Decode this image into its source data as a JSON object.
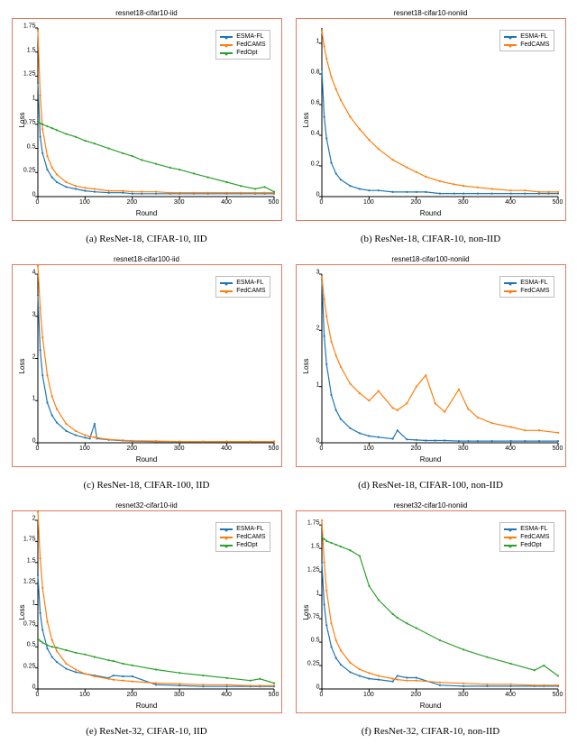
{
  "colors": {
    "blue": "#1f77b4",
    "orange": "#ff7f0e",
    "green": "#2ca02c"
  },
  "legend_labels": {
    "esma": "ESMA-FL",
    "fedcams": "FedCAMS",
    "fedopt": "FedOpt"
  },
  "axis_labels": {
    "x": "Round",
    "y": "Loss"
  },
  "chart_data": [
    {
      "id": "a",
      "title": "resnet18-cifar10-iid",
      "caption": "(a) ResNet-18, CIFAR-10, IID",
      "type": "line",
      "xlim": [
        0,
        500
      ],
      "ylim": [
        0.0,
        1.75
      ],
      "xticks": [
        0,
        100,
        200,
        300,
        400,
        500
      ],
      "yticks": [
        0.0,
        0.25,
        0.5,
        0.75,
        1.0,
        1.25,
        1.5,
        1.75
      ],
      "legend": [
        "esma",
        "fedcams",
        "fedopt"
      ],
      "x": [
        0,
        5,
        10,
        20,
        30,
        40,
        60,
        80,
        100,
        120,
        150,
        180,
        200,
        220,
        250,
        280,
        300,
        330,
        360,
        400,
        430,
        460,
        480,
        500
      ],
      "series": [
        {
          "key": "esma",
          "color": "blue",
          "values": [
            1.18,
            0.62,
            0.45,
            0.28,
            0.2,
            0.15,
            0.1,
            0.08,
            0.06,
            0.05,
            0.04,
            0.04,
            0.03,
            0.03,
            0.03,
            0.03,
            0.03,
            0.03,
            0.03,
            0.03,
            0.03,
            0.03,
            0.03,
            0.03
          ]
        },
        {
          "key": "fedcams",
          "color": "orange",
          "values": [
            1.72,
            1.05,
            0.7,
            0.42,
            0.3,
            0.23,
            0.15,
            0.11,
            0.09,
            0.08,
            0.06,
            0.06,
            0.05,
            0.05,
            0.05,
            0.04,
            0.04,
            0.04,
            0.04,
            0.04,
            0.04,
            0.04,
            0.04,
            0.04
          ]
        },
        {
          "key": "fedopt",
          "color": "green",
          "values": [
            0.78,
            0.76,
            0.75,
            0.73,
            0.71,
            0.69,
            0.65,
            0.62,
            0.58,
            0.55,
            0.5,
            0.45,
            0.42,
            0.38,
            0.34,
            0.3,
            0.28,
            0.24,
            0.2,
            0.15,
            0.11,
            0.08,
            0.1,
            0.05
          ]
        }
      ]
    },
    {
      "id": "b",
      "title": "resnet18-cifar10-noniid",
      "caption": "(b) ResNet-18, CIFAR-10, non-IID",
      "type": "line",
      "xlim": [
        0,
        500
      ],
      "ylim": [
        0.0,
        1.1
      ],
      "xticks": [
        0,
        100,
        200,
        300,
        400,
        500
      ],
      "yticks": [
        0.0,
        0.2,
        0.4,
        0.6,
        0.8,
        1.0
      ],
      "legend": [
        "esma",
        "fedcams"
      ],
      "x": [
        0,
        5,
        10,
        20,
        30,
        40,
        60,
        80,
        100,
        120,
        150,
        180,
        200,
        220,
        250,
        280,
        300,
        330,
        360,
        400,
        430,
        460,
        480,
        500
      ],
      "series": [
        {
          "key": "esma",
          "color": "blue",
          "values": [
            0.83,
            0.52,
            0.38,
            0.22,
            0.15,
            0.11,
            0.07,
            0.05,
            0.04,
            0.04,
            0.03,
            0.03,
            0.03,
            0.03,
            0.02,
            0.02,
            0.02,
            0.02,
            0.02,
            0.02,
            0.02,
            0.02,
            0.02,
            0.02
          ]
        },
        {
          "key": "fedcams",
          "color": "orange",
          "values": [
            1.08,
            0.98,
            0.9,
            0.78,
            0.7,
            0.63,
            0.52,
            0.44,
            0.37,
            0.31,
            0.24,
            0.19,
            0.16,
            0.13,
            0.1,
            0.08,
            0.07,
            0.06,
            0.05,
            0.04,
            0.04,
            0.03,
            0.03,
            0.03
          ]
        }
      ]
    },
    {
      "id": "c",
      "title": "resnet18-cifar100-iid",
      "caption": "(c) ResNet-18, CIFAR-100, IID",
      "type": "line",
      "xlim": [
        0,
        500
      ],
      "ylim": [
        0,
        4
      ],
      "xticks": [
        0,
        100,
        200,
        300,
        400,
        500
      ],
      "yticks": [
        0,
        1,
        2,
        3,
        4
      ],
      "legend": [
        "esma",
        "fedcams"
      ],
      "x": [
        0,
        5,
        10,
        20,
        30,
        40,
        60,
        80,
        100,
        110,
        120,
        125,
        150,
        180,
        200,
        250,
        300,
        350,
        400,
        450,
        500
      ],
      "series": [
        {
          "key": "esma",
          "color": "blue",
          "values": [
            3.5,
            2.2,
            1.6,
            0.95,
            0.65,
            0.48,
            0.28,
            0.18,
            0.12,
            0.1,
            0.45,
            0.1,
            0.07,
            0.05,
            0.04,
            0.03,
            0.03,
            0.03,
            0.03,
            0.03,
            0.03
          ]
        },
        {
          "key": "fedcams",
          "color": "orange",
          "values": [
            4.2,
            3.2,
            2.5,
            1.6,
            1.1,
            0.8,
            0.45,
            0.28,
            0.18,
            0.15,
            0.13,
            0.12,
            0.08,
            0.06,
            0.05,
            0.04,
            0.03,
            0.03,
            0.03,
            0.03,
            0.03
          ]
        }
      ]
    },
    {
      "id": "d",
      "title": "resnet18-cifar100-noniid",
      "caption": "(d) ResNet-18, CIFAR-100, non-IID",
      "type": "line",
      "xlim": [
        0,
        500
      ],
      "ylim": [
        0,
        3
      ],
      "xticks": [
        0,
        100,
        200,
        300,
        400,
        500
      ],
      "yticks": [
        0,
        1,
        2,
        3
      ],
      "legend": [
        "esma",
        "fedcams"
      ],
      "x": [
        0,
        5,
        10,
        20,
        30,
        40,
        60,
        80,
        100,
        120,
        150,
        160,
        180,
        200,
        220,
        240,
        260,
        290,
        310,
        330,
        360,
        400,
        430,
        460,
        500
      ],
      "series": [
        {
          "key": "esma",
          "color": "blue",
          "values": [
            2.9,
            1.9,
            1.4,
            0.85,
            0.58,
            0.42,
            0.26,
            0.17,
            0.12,
            0.1,
            0.07,
            0.22,
            0.06,
            0.05,
            0.04,
            0.04,
            0.04,
            0.03,
            0.03,
            0.03,
            0.03,
            0.03,
            0.03,
            0.03,
            0.03
          ]
        },
        {
          "key": "fedcams",
          "color": "orange",
          "values": [
            2.95,
            2.55,
            2.25,
            1.8,
            1.55,
            1.35,
            1.05,
            0.88,
            0.75,
            0.92,
            0.62,
            0.58,
            0.7,
            1.0,
            1.2,
            0.7,
            0.55,
            0.95,
            0.6,
            0.45,
            0.35,
            0.28,
            0.22,
            0.22,
            0.18
          ]
        }
      ]
    },
    {
      "id": "e",
      "title": "resnet32-cifar10-iid",
      "caption": "(e) ResNet-32, CIFAR-10, IID",
      "type": "line",
      "xlim": [
        0,
        500
      ],
      "ylim": [
        0.0,
        2.0
      ],
      "xticks": [
        0,
        100,
        200,
        300,
        400,
        500
      ],
      "yticks": [
        0.0,
        0.25,
        0.5,
        0.75,
        1.0,
        1.25,
        1.5,
        1.75,
        2.0
      ],
      "legend": [
        "esma",
        "fedcams",
        "fedopt"
      ],
      "x": [
        0,
        5,
        10,
        20,
        30,
        40,
        60,
        80,
        100,
        120,
        150,
        160,
        180,
        200,
        250,
        300,
        350,
        400,
        450,
        470,
        500
      ],
      "series": [
        {
          "key": "esma",
          "color": "blue",
          "values": [
            1.35,
            0.9,
            0.7,
            0.48,
            0.38,
            0.32,
            0.24,
            0.2,
            0.18,
            0.16,
            0.13,
            0.16,
            0.15,
            0.15,
            0.05,
            0.04,
            0.03,
            0.03,
            0.03,
            0.03,
            0.03
          ]
        },
        {
          "key": "fedcams",
          "color": "orange",
          "values": [
            2.1,
            1.55,
            1.2,
            0.8,
            0.58,
            0.45,
            0.3,
            0.23,
            0.18,
            0.15,
            0.12,
            0.11,
            0.1,
            0.09,
            0.07,
            0.06,
            0.05,
            0.05,
            0.04,
            0.04,
            0.04
          ]
        },
        {
          "key": "fedopt",
          "color": "green",
          "values": [
            0.6,
            0.57,
            0.55,
            0.52,
            0.5,
            0.49,
            0.46,
            0.43,
            0.41,
            0.38,
            0.34,
            0.33,
            0.3,
            0.28,
            0.23,
            0.19,
            0.16,
            0.13,
            0.1,
            0.12,
            0.07
          ]
        }
      ]
    },
    {
      "id": "f",
      "title": "resnet32-cifar10-noniid",
      "caption": "(f) ResNet-32, CIFAR-10, non-IID",
      "type": "line",
      "xlim": [
        0,
        500
      ],
      "ylim": [
        0.0,
        1.8
      ],
      "xticks": [
        0,
        100,
        200,
        300,
        400,
        500
      ],
      "yticks": [
        0.0,
        0.25,
        0.5,
        0.75,
        1.0,
        1.25,
        1.5,
        1.75
      ],
      "legend": [
        "esma",
        "fedcams",
        "fedopt"
      ],
      "x": [
        0,
        5,
        10,
        20,
        30,
        40,
        60,
        80,
        100,
        120,
        150,
        160,
        180,
        200,
        250,
        300,
        350,
        400,
        450,
        470,
        500
      ],
      "series": [
        {
          "key": "esma",
          "color": "blue",
          "values": [
            1.35,
            0.9,
            0.68,
            0.45,
            0.33,
            0.26,
            0.18,
            0.14,
            0.11,
            0.1,
            0.08,
            0.14,
            0.12,
            0.12,
            0.04,
            0.03,
            0.03,
            0.03,
            0.03,
            0.03,
            0.03
          ]
        },
        {
          "key": "fedcams",
          "color": "orange",
          "values": [
            1.8,
            1.35,
            1.05,
            0.7,
            0.52,
            0.41,
            0.28,
            0.21,
            0.17,
            0.14,
            0.11,
            0.1,
            0.09,
            0.09,
            0.07,
            0.06,
            0.05,
            0.05,
            0.04,
            0.04,
            0.04
          ]
        },
        {
          "key": "fedopt",
          "color": "green",
          "values": [
            1.62,
            1.6,
            1.58,
            1.56,
            1.54,
            1.52,
            1.48,
            1.42,
            1.1,
            0.95,
            0.8,
            0.76,
            0.7,
            0.65,
            0.52,
            0.42,
            0.34,
            0.27,
            0.2,
            0.25,
            0.14
          ]
        }
      ]
    }
  ]
}
